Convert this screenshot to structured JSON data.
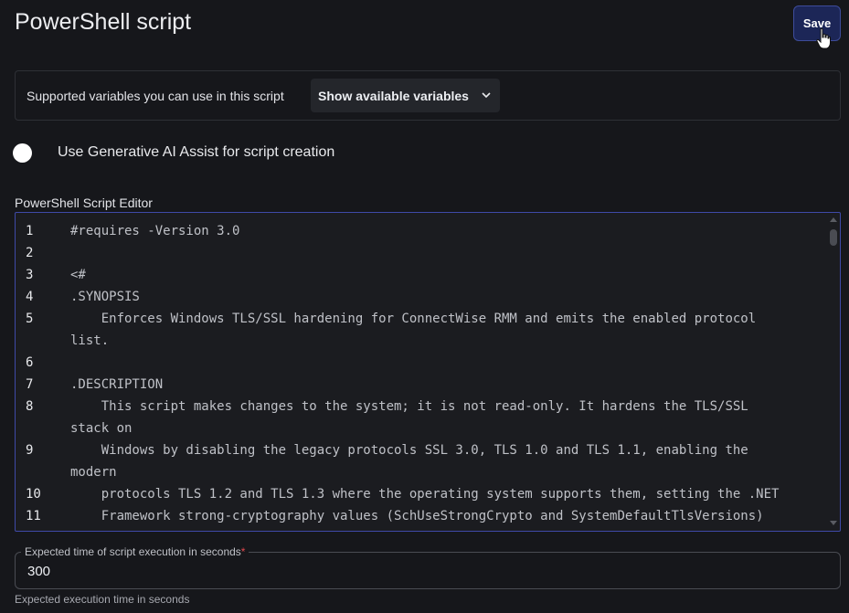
{
  "header": {
    "title": "PowerShell script",
    "save_label": "Save"
  },
  "variables": {
    "label": "Supported variables you can use in this script",
    "dropdown_label": "Show available variables"
  },
  "ai_assist": {
    "label": "Use Generative AI Assist for script creation",
    "enabled": false
  },
  "editor": {
    "label": "PowerShell Script Editor",
    "lines": [
      {
        "num": "1",
        "text": "#requires -Version 3.0",
        "wrap": ""
      },
      {
        "num": "2",
        "text": "",
        "wrap": ""
      },
      {
        "num": "3",
        "text": "<#",
        "wrap": ""
      },
      {
        "num": "4",
        "text": ".SYNOPSIS",
        "wrap": ""
      },
      {
        "num": "5",
        "text": "    Enforces Windows TLS/SSL hardening for ConnectWise RMM and emits the enabled protocol",
        "wrap": "list."
      },
      {
        "num": "6",
        "text": "",
        "wrap": ""
      },
      {
        "num": "7",
        "text": ".DESCRIPTION",
        "wrap": ""
      },
      {
        "num": "8",
        "text": "    This script makes changes to the system; it is not read-only. It hardens the TLS/SSL",
        "wrap": "stack on"
      },
      {
        "num": "9",
        "text": "    Windows by disabling the legacy protocols SSL 3.0, TLS 1.0 and TLS 1.1, enabling the",
        "wrap": "modern"
      },
      {
        "num": "10",
        "text": "    protocols TLS 1.2 and TLS 1.3 where the operating system supports them, setting the .NET",
        "wrap": ""
      },
      {
        "num": "11",
        "text": "    Framework strong-cryptography values (SchUseStrongCrypto and SystemDefaultTlsVersions)",
        "wrap": ""
      }
    ]
  },
  "execution_time": {
    "legend": "Expected time of script execution in seconds",
    "required_mark": "*",
    "value": "300",
    "help": "Expected execution time in seconds"
  },
  "colors": {
    "background": "#16171b",
    "save_button": "#1c2657",
    "editor_border": "#3f4aa8",
    "required": "#e0484e"
  }
}
